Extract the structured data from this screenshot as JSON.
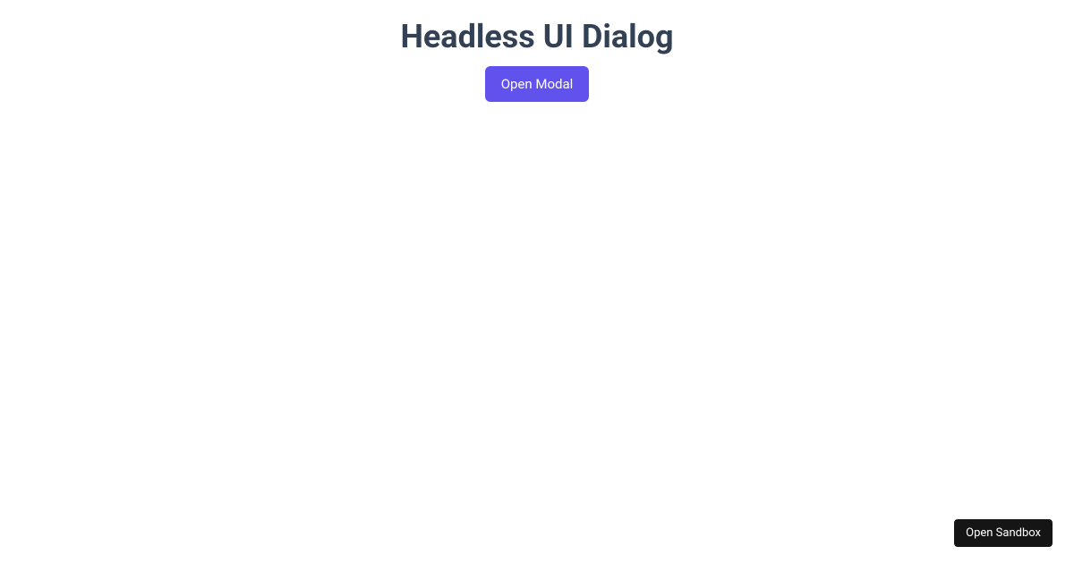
{
  "header": {
    "title": "Headless UI Dialog"
  },
  "main": {
    "open_modal_label": "Open Modal"
  },
  "footer": {
    "sandbox_label": "Open Sandbox"
  },
  "colors": {
    "primary": "#6152ee",
    "title": "#334155",
    "sandbox_bg": "#151515"
  }
}
